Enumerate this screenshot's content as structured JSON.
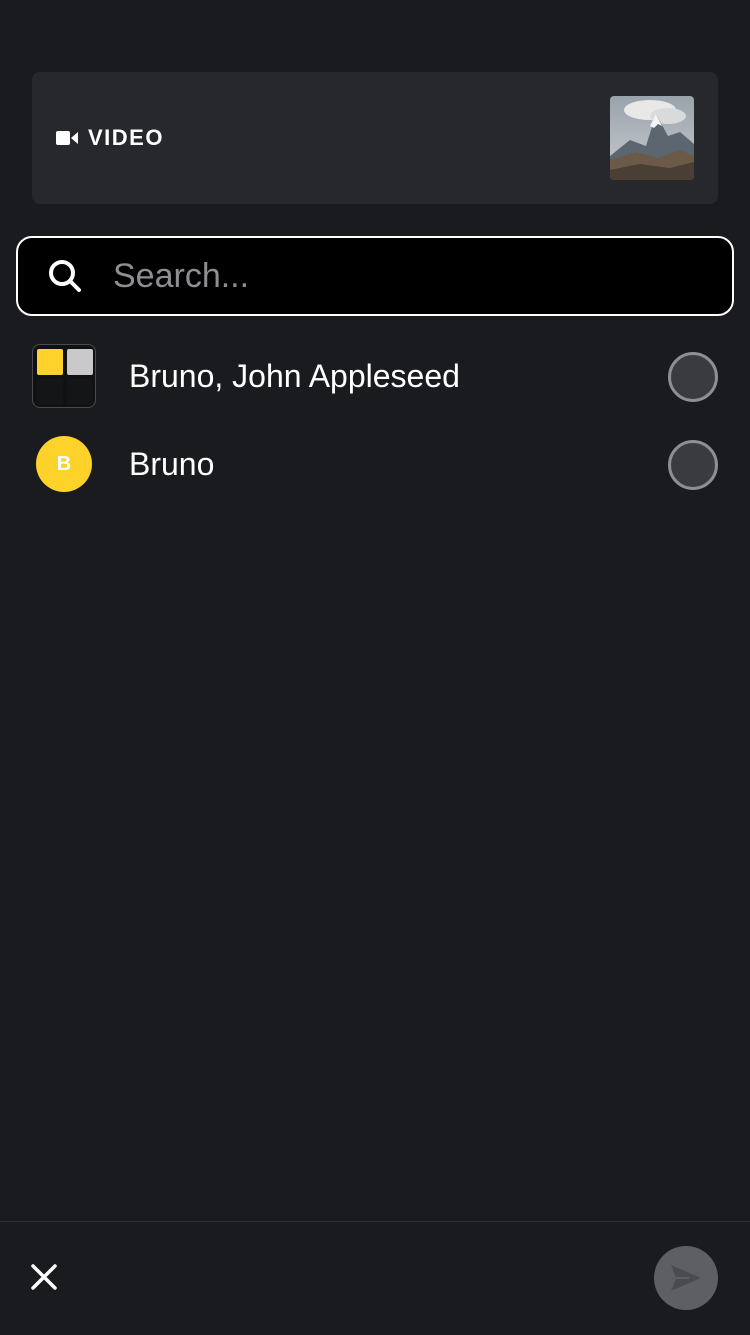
{
  "media_card": {
    "type_icon": "video-camera-icon",
    "type_label": "VIDEO",
    "thumbnail": "mountain-thumbnail"
  },
  "search": {
    "icon": "search-icon",
    "placeholder": "Search...",
    "value": ""
  },
  "contacts": [
    {
      "name": "Bruno, John Appleseed",
      "avatar": "group-avatar",
      "selected": false
    },
    {
      "name": "Bruno",
      "avatar_initial": "B",
      "avatar_color": "#fdd22a",
      "selected": false
    }
  ],
  "bottom_bar": {
    "close_icon": "close-icon",
    "send_icon": "send-icon"
  },
  "colors": {
    "background": "#1a1b1e",
    "card": "#27282c",
    "accent_yellow": "#fdd22a",
    "send_button": "#5e5f63"
  }
}
